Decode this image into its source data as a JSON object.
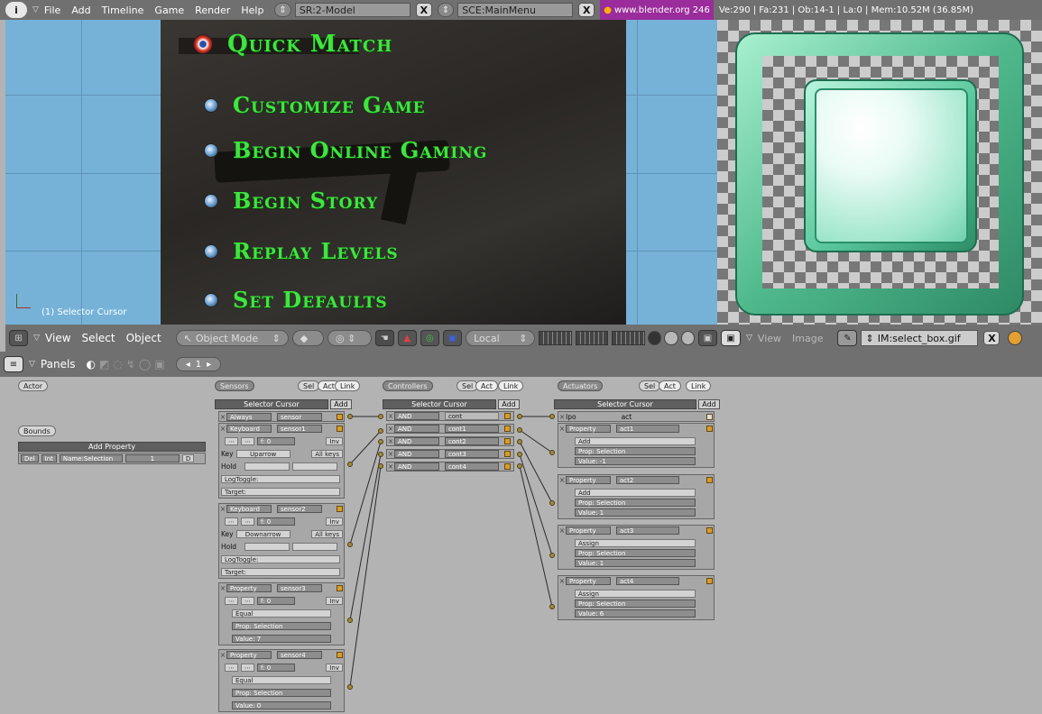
{
  "topbar": {
    "info": "i",
    "menus": [
      "File",
      "Add",
      "Timeline",
      "Game",
      "Render",
      "Help"
    ],
    "screen": "SR:2-Model",
    "scene": "SCE:MainMenu",
    "close": "X",
    "web": "www.blender.org 246",
    "stats": "Ve:290 | Fa:231 | Ob:14-1 | La:0  | Mem:10.52M (36.85M)"
  },
  "viewport": {
    "label": "(1) Selector Cursor",
    "menu_entries": [
      "Quick Match",
      "Customize Game",
      "Begin Online Gaming",
      "Begin Story",
      "Replay Levels",
      "Set Defaults"
    ]
  },
  "vpbar": {
    "menus": [
      "View",
      "Select",
      "Object"
    ],
    "mode": "Object Mode",
    "pivot": "Local"
  },
  "imgbar": {
    "menus": [
      "View",
      "Image"
    ],
    "image_name": "IM:select_box.gif",
    "close": "X"
  },
  "logicbar": {
    "panels": "Panels",
    "page": "1"
  },
  "logic": {
    "actor": "Actor",
    "bounds": "Bounds",
    "add_property": "Add Property",
    "prop_row": {
      "del": "Del",
      "type": "Int",
      "name": "Name:Selection",
      "value": "1",
      "d": "D"
    },
    "sensors_label": "Sensors",
    "controllers_label": "Controllers",
    "actuators_label": "Actuators",
    "sel": "Sel",
    "act": "Act",
    "link": "Link",
    "object_name": "Selector Cursor",
    "add": "Add",
    "sensors": [
      {
        "type": "Always",
        "name": "sensor"
      },
      {
        "type": "Keyboard",
        "name": "sensor1",
        "key": "Key",
        "keyval": "Uparrow",
        "allkeys": "All keys",
        "hold": "Hold",
        "log": "LogToggle:",
        "target": "Target:",
        "freq": "f: 0",
        "inv": "Inv"
      },
      {
        "type": "Keyboard",
        "name": "sensor2",
        "key": "Key",
        "keyval": "Downarrow",
        "allkeys": "All keys",
        "hold": "Hold",
        "log": "LogToggle:",
        "target": "Target:",
        "freq": "f: 0",
        "inv": "Inv"
      },
      {
        "type": "Property",
        "name": "sensor3",
        "mode": "Equal",
        "prop": "Prop: Selection",
        "value": "Value: 7",
        "freq": "f: 0",
        "inv": "Inv"
      },
      {
        "type": "Property",
        "name": "sensor4",
        "mode": "Equal",
        "prop": "Prop: Selection",
        "value": "Value: 0",
        "freq": "f: 0",
        "inv": "Inv"
      }
    ],
    "controllers": [
      {
        "type": "AND",
        "name": "cont"
      },
      {
        "type": "AND",
        "name": "cont1"
      },
      {
        "type": "AND",
        "name": "cont2"
      },
      {
        "type": "AND",
        "name": "cont3"
      },
      {
        "type": "AND",
        "name": "cont4"
      }
    ],
    "actuators": [
      {
        "type": "Ipo",
        "name": "act"
      },
      {
        "type": "Property",
        "name": "act1",
        "mode": "Add",
        "prop": "Prop: Selection",
        "value": "Value: -1"
      },
      {
        "type": "Property",
        "name": "act2",
        "mode": "Add",
        "prop": "Prop: Selection",
        "value": "Value: 1"
      },
      {
        "type": "Property",
        "name": "act3",
        "mode": "Assign",
        "prop": "Prop: Selection",
        "value": "Value: 1"
      },
      {
        "type": "Property",
        "name": "act4",
        "mode": "Assign",
        "prop": "Prop: Selection",
        "value": "Value: 6"
      }
    ]
  }
}
